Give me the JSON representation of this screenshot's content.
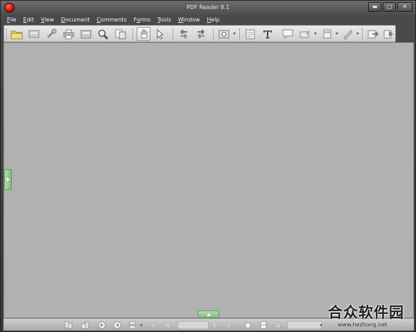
{
  "window": {
    "title": "PDF Reader 8.1"
  },
  "titlebar": {
    "minimize": "▬",
    "maximize": "▢",
    "close": "✕"
  },
  "menu": [
    {
      "label": "File",
      "key": "F",
      "rest": "ile"
    },
    {
      "label": "Edit",
      "key": "E",
      "rest": "dit"
    },
    {
      "label": "View",
      "key": "V",
      "rest": "iew"
    },
    {
      "label": "Document",
      "key": "D",
      "rest": "ocument"
    },
    {
      "label": "Comments",
      "key": "C",
      "rest": "omments"
    },
    {
      "label": "Forms",
      "key": "o",
      "pre": "F",
      "rest": "rms"
    },
    {
      "label": "Tools",
      "key": "T",
      "rest": "ools"
    },
    {
      "label": "Window",
      "key": "W",
      "rest": "indow"
    },
    {
      "label": "Help",
      "key": "H",
      "rest": "elp"
    }
  ],
  "toolbar": {
    "icons": [
      "open-folder-icon",
      "scanner-icon",
      "tools-icon",
      "print-icon",
      "fax-icon",
      "search-icon",
      "pages-icon",
      "hand-tool-icon",
      "select-tool-icon",
      "rotate-left-icon",
      "rotate-right-icon",
      "snapshot-icon",
      "note-icon",
      "text-tool-icon",
      "comment-icon",
      "highlight-icon",
      "stamp-icon",
      "pen-icon",
      "export-icon",
      "forward-icon"
    ]
  },
  "statusbar": {
    "page_input": "",
    "zoom_input": ""
  },
  "watermark": {
    "chinese": "合众软件园",
    "url": "www.hezhong.net"
  },
  "colors": {
    "canvas": "#b1b1b1",
    "panel_tab": "#7fbc78",
    "chrome": "#4a4a4a"
  }
}
